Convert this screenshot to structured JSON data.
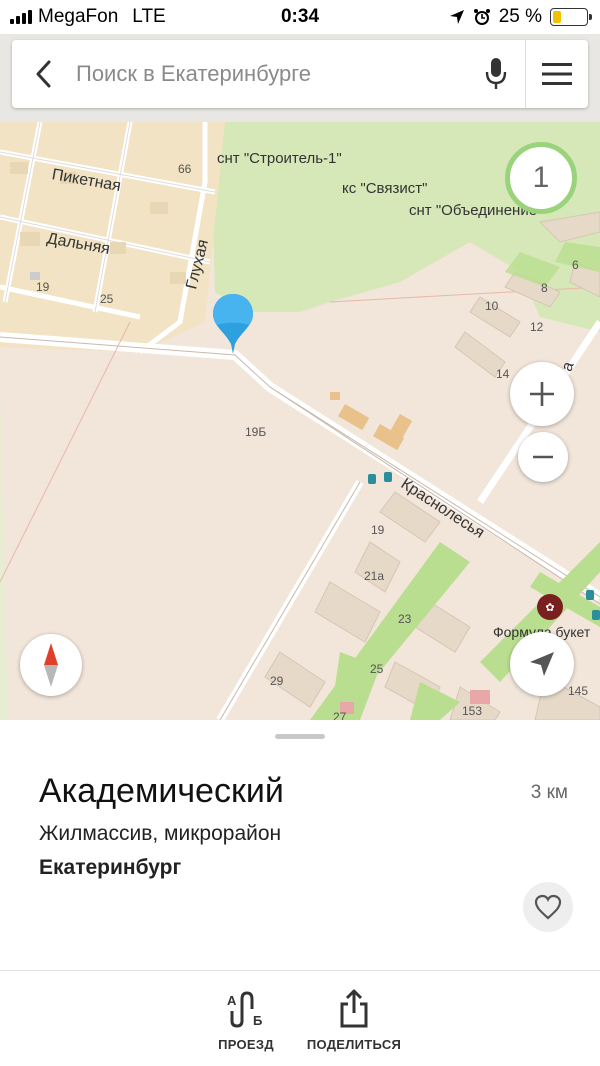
{
  "status_bar": {
    "carrier": "MegaFon",
    "network": "LTE",
    "time": "0:34",
    "battery": "25 %",
    "battery_level": 0.25
  },
  "search": {
    "placeholder": "Поиск в Екатеринбурге",
    "back_icon": "chevron-left-icon",
    "mic_icon": "microphone-icon",
    "menu_icon": "hamburger-icon"
  },
  "map": {
    "cluster_count": "1",
    "labels": {
      "snt_stroitel": "снт \"Строитель-1\"",
      "ks_svyazist": "кс \"Связист\"",
      "snt_obedinenie": "снт \"Объединение\""
    },
    "streets": {
      "piketnaya": "Пикетная",
      "dalnyaya": "Дальняя",
      "glukhaya": "Глухая",
      "krasnolesya": "Краснолесья",
      "a_street": "а"
    },
    "house_numbers": {
      "n66": "66",
      "n19a": "19",
      "n25a": "25",
      "n19b": "19Б",
      "n6": "6",
      "n8": "8",
      "n10": "10",
      "n12": "12",
      "n14": "14",
      "n19": "19",
      "n21a": "21а",
      "n23": "23",
      "n25": "25",
      "n29": "29",
      "n27": "27",
      "n153": "153",
      "n145": "145"
    },
    "poi_label": "Формула букет",
    "colors": {
      "land": "#f2e5da",
      "green": "#d6e8b8",
      "park": "#b9de8f",
      "residential": "#f1e3c3",
      "pin": "#2da0e0",
      "cluster_ring": "#9bd37c"
    }
  },
  "place": {
    "title": "Академический",
    "distance": "3 км",
    "type": "Жилмассив, микрорайон",
    "city": "Екатеринбург"
  },
  "actions": {
    "route_label": "ПРОЕЗД",
    "share_label": "ПОДЕЛИТЬСЯ",
    "route_icon_letters": {
      "a": "А",
      "b": "Б"
    }
  }
}
